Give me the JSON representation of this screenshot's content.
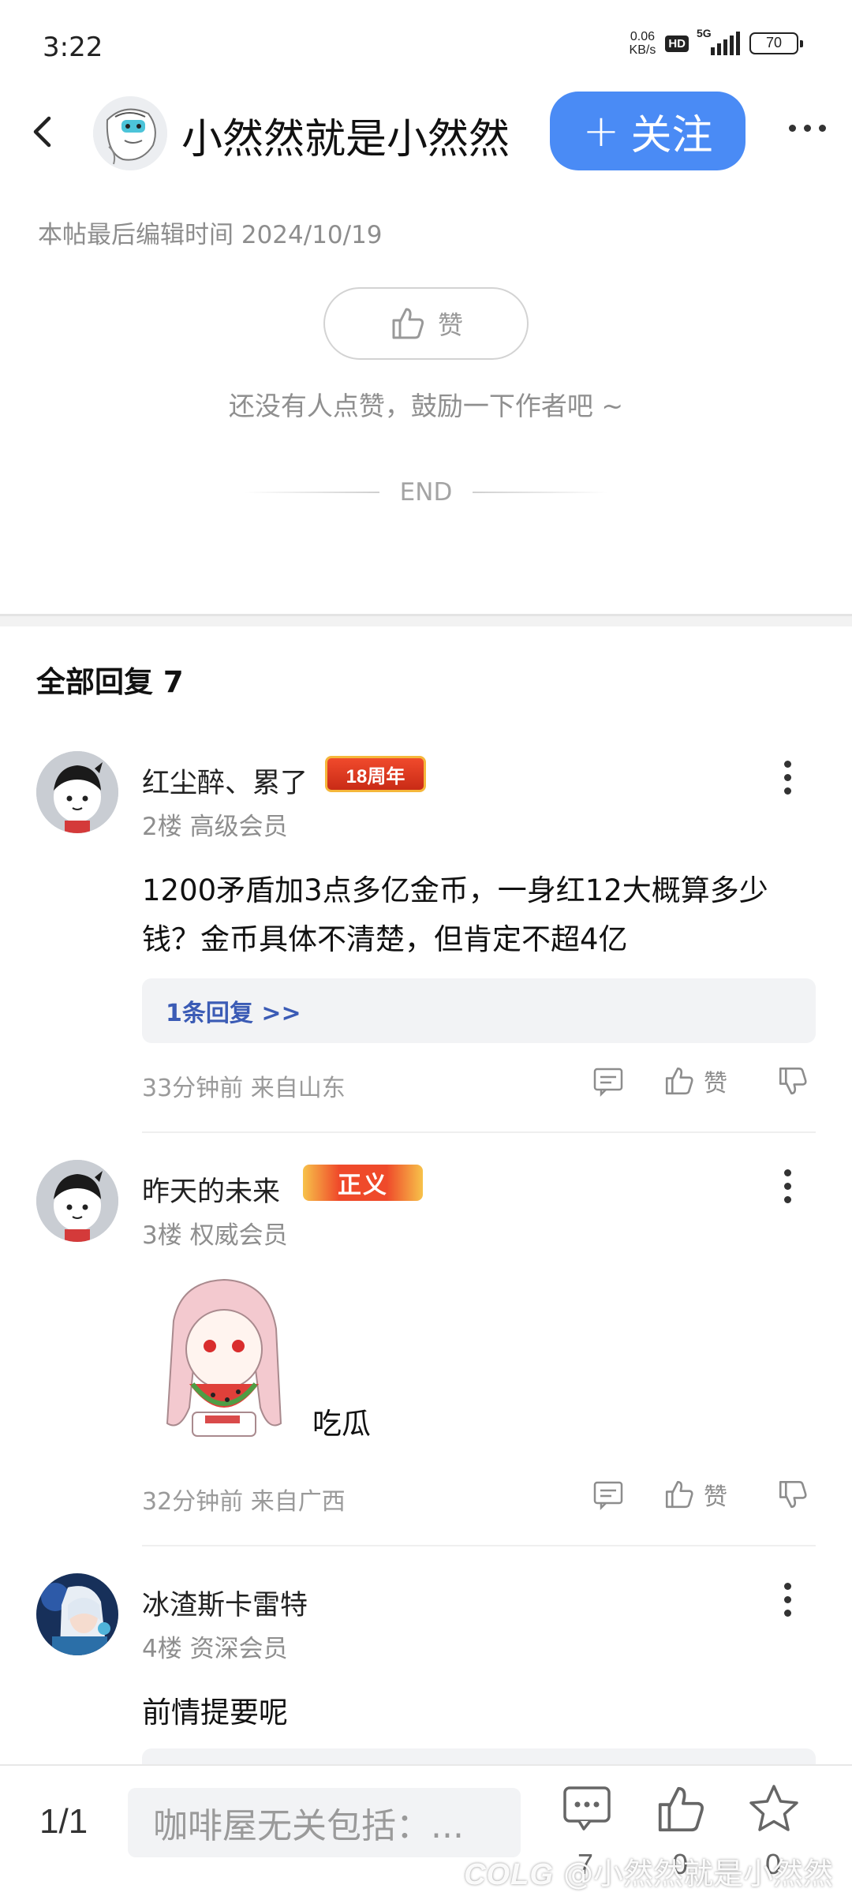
{
  "status_bar": {
    "time": "3:22",
    "net_speed_value": "0.06",
    "net_speed_unit": "KB/s",
    "hd": "HD",
    "network": "5G",
    "battery": "70"
  },
  "header": {
    "author_name": "小然然就是小然然",
    "follow_plus": "+",
    "follow_label": "关注",
    "icons": [
      "back-icon",
      "more-icon"
    ]
  },
  "post": {
    "edit_time": "本帖最后编辑时间 2024/10/19",
    "like_label": "赞",
    "no_like_tip": "还没有人点赞，鼓励一下作者吧 ~",
    "end_text": "END"
  },
  "replies": {
    "title": "全部回复 7",
    "items": [
      {
        "name": "红尘醉、累了",
        "badge": "18周年",
        "meta": "2楼 高级会员",
        "content_lines": [
          "1200矛盾加3点多亿金币，一身红12大概算多少",
          "钱？金币具体不清楚，但肯定不超4亿"
        ],
        "subreply": "1条回复 >>",
        "time": "33分钟前 来自山东",
        "like_label": "赞"
      },
      {
        "name": "昨天的未来",
        "badge": "正义",
        "meta": "3楼 权威会员",
        "sticker_caption": "吃瓜",
        "time": "32分钟前 来自广西",
        "like_label": "赞"
      },
      {
        "name": "冰渣斯卡雷特",
        "meta": "4楼 资深会员",
        "content_lines": [
          "前情提要呢"
        ]
      }
    ]
  },
  "bottom_bar": {
    "page": "1/1",
    "input_placeholder": "咖啡屋无关包括：...",
    "comment_count": "7",
    "like_count": "0",
    "fav_count": "0",
    "watermark_logo": "COLG",
    "watermark_text": "@小然然就是小然然"
  },
  "colors": {
    "accent": "#4a8bf5",
    "subreply_link": "#3b5bb5",
    "badge_red": "#e8452c"
  }
}
